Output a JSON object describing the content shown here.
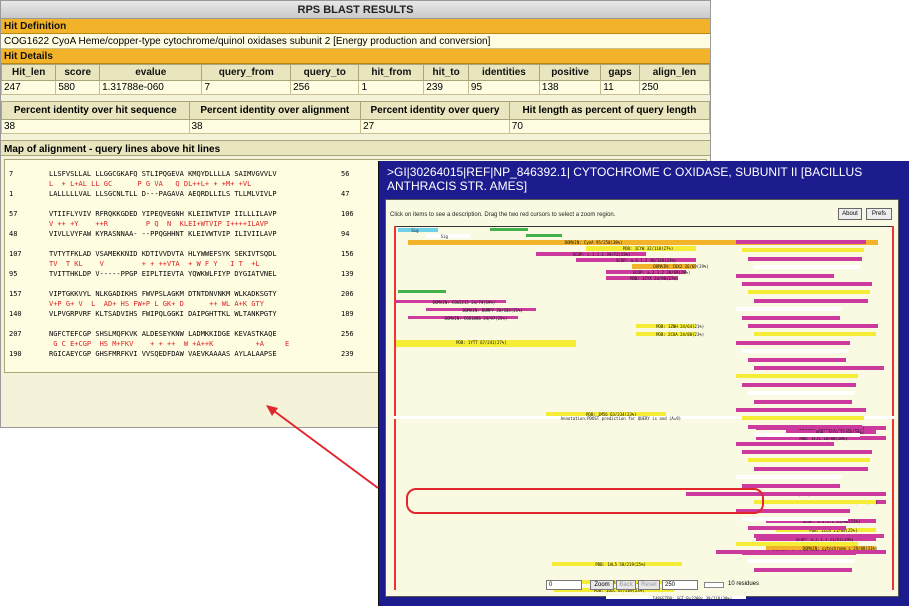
{
  "title": "RPS BLAST RESULTS",
  "hit_definition": {
    "heading": "Hit Definition",
    "text": "COG1622 CyoA Heme/copper-type cytochrome/quinol oxidases subunit 2 [Energy production and conversion]"
  },
  "hit_details": {
    "heading": "Hit Details",
    "columns": [
      "Hit_len",
      "score",
      "evalue",
      "query_from",
      "query_to",
      "hit_from",
      "hit_to",
      "identities",
      "positive",
      "gaps",
      "align_len"
    ],
    "values": [
      "247",
      "580",
      "1.31788e-060",
      "7",
      "256",
      "1",
      "239",
      "95",
      "138",
      "11",
      "250"
    ]
  },
  "percent": {
    "columns": [
      "Percent identity over hit sequence",
      "Percent identity over alignment",
      "Percent identity over query",
      "Hit length as percent of query length"
    ],
    "values": [
      "38",
      "38",
      "27",
      "70"
    ]
  },
  "map": {
    "heading": "Map of alignment - query lines above hit lines",
    "blocks": [
      {
        "q_start": "7",
        "q": "LLSFVSLLAL LLGGCGKAFQ STLIPQGEVA KMQYDLLLLA SAIMVGVVLV",
        "q_end": "56",
        "m": "L  + L+AL LL GC      P G VA   Q DL++L+ + +M+ +VL",
        "h_start": "1",
        "h": "LALLLLLVAL LLSGCNLTLL D---PAGAVA AEQRDLLILS TLLMLVIVLP",
        "h_end": "47"
      },
      {
        "q_start": "57",
        "q": "VTIIFLYVIV RFRQKKGDED YIPEQVEGNH KLEIIWTVIP IILLLILAVP",
        "q_end": "106",
        "m": "V ++ +Y    ++R         P Q  N  KLEI+WTVIP I++++ILAVP",
        "h_start": "48",
        "h": "VIVLLVYFAW KYRASNNAA- --PPQGHHNT KLEIVWTVIP ILIVIILAVP",
        "h_end": "94"
      },
      {
        "q_start": "107",
        "q": "TVTYTFKLAD VSAMEKKNID KDTIVVDVTA HLYWWEFSYK SEKIVTSQDL",
        "q_end": "156",
        "m": "TV  T KL    V         + + ++VTA  + W F Y   I T  +L",
        "h_start": "95",
        "h": "TVITTHKLDP V-----PPGP EIPLTIEVTA YQWKWLFIYP DYGIATVNEL",
        "h_end": "139"
      },
      {
        "q_start": "157",
        "q": "VIPTGKKVYL NLKGADIKHS FWVPSLAGKM DTNTDNVNKM WLKADKSGTY",
        "q_end": "206",
        "m": "V+P G+ V  L  AD+ HS FW+P L GK+ D      ++ WL A+K GTY",
        "h_start": "140",
        "h": "VLPVGRPVRF KLTSADVIHS FWIPQLGGKI DAIPGHTTKL WLTANKPGTY",
        "h_end": "189"
      },
      {
        "q_start": "207",
        "q": "NGFCTEFCGP SHSLMQFKVK ALDESEYKNW LADMKKIDGE KEVASTKAQE",
        "q_end": "256",
        "m": " G C E+CGP  HS M+FKV    + + ++  W +A++K          +A     E",
        "h_start": "190",
        "h": "RGICAEYCGP GHSFMRFKVI VVSQEDFDAW VAEVKAAAAS AYLALAAPSE",
        "h_end": "239"
      }
    ]
  },
  "graph": {
    "title": ">GI|30264015|REF|NP_846392.1| CYTOCHROME C OXIDASE, SUBUNIT II [BACILLUS ANTHRACIS STR. AMES]",
    "instruction": "Click on items to see a description. Drag the two red cursors to select a zoom region.",
    "about": "About",
    "prefs": "Prefs",
    "labels": [
      "Sig",
      "PDB: 1CYX 37/118(31%)",
      "PDB: 1CYW 32/118(27%)",
      "SCOP: c.1.1.1 39/72(23%)",
      "SCOP: a.3.1.2 38/118(31%)",
      "DOMAIN: COX2 26/69(29%)",
      "SCOP: a.3.1.2 28/69(29%)",
      "PDB: 1CYX 24/98(27%)",
      "DOMAIN: COG2215 24/74(19%)",
      "DOMAIN: DUMP7 20/103(21%)",
      "DOMAIN: COG1886 24/97(25%)",
      "PDB: 1ZNH 24/64(21%)",
      "PDB: 2CUA 24/88(23%)",
      "PDB: 1YTT 67/241(27%)",
      "PDB: 1M56 63/234(23%)",
      "PDB: 1AL5 58/219(25%)",
      "PDB: 1AR1 58/219(26%)",
      "PDB: 1OCC 67/269(23%)",
      "TARGETDB: SGT:Rv2200c 39/118(30%)",
      "DOMAIN: CyoA 95/250(38%)",
      "Annotation:PDOST prediction for QUERY is and (A=9)",
      "DOMAIN: CYT1 36/227(16%)",
      "DOMAIN: CcoA 20/118(17%)",
      "PDB: 1FIC 18/80(20%)",
      "DOMAIN: COG2863 29/108(26%)",
      "DOMAIN: COG3474 30/117(26%)",
      "PDB: 1CC0 22/99(20%)",
      "SCOP: a.3.1.1 21/96(21%)",
      "PDB: 2CCM 21/84(25%)",
      "SCOP: a.3.1.1 21/61(34%)",
      "DOMAIN: cytochrome c 29/88(31%)"
    ],
    "zoom_value": "0",
    "zoom_btn": "Zoom",
    "back_btn": "Back",
    "reset_btn": "Reset",
    "end_value": "250",
    "scale": "10 residues"
  }
}
